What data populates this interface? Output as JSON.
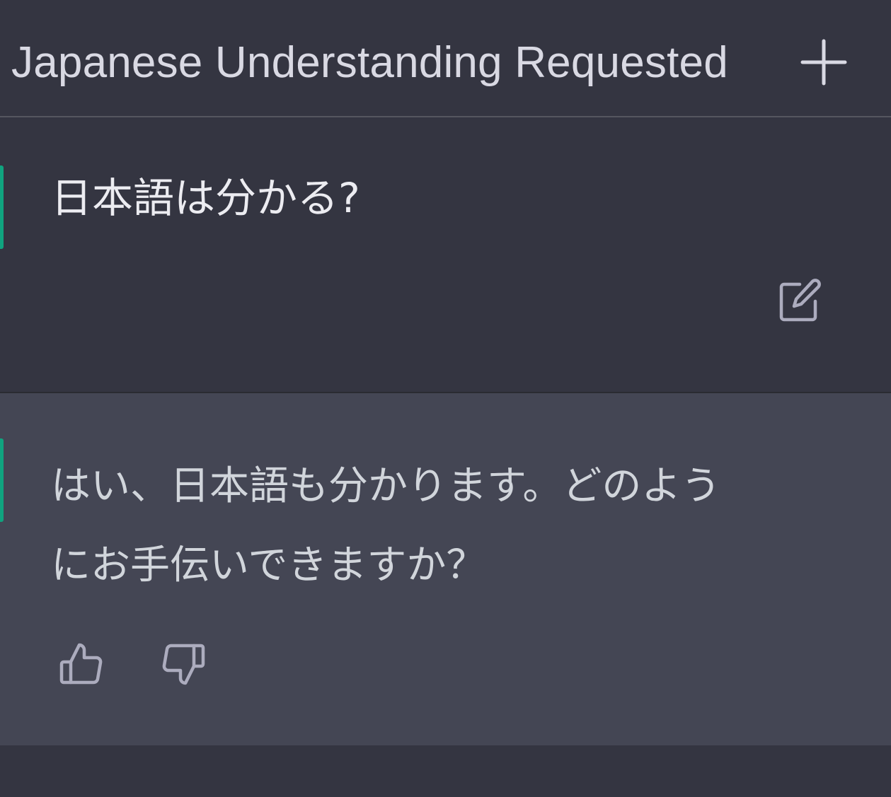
{
  "header": {
    "title": "Japanese Understanding Requested",
    "new_chat_icon": "plus-icon"
  },
  "conversation": {
    "user_message": {
      "text": "日本語は分かる?",
      "edit_icon": "edit-icon"
    },
    "assistant_message": {
      "lines": [
        "はい、日本語も分かります。どのよう",
        "にお手伝いできますか？"
      ],
      "feedback_icons": [
        "thumbs-up-icon",
        "thumbs-down-icon"
      ]
    }
  },
  "colors": {
    "background": "#343541",
    "assistant_background": "#444654",
    "accent": "#10a37f",
    "text": "#ececf1",
    "icon": "#acacbe"
  }
}
